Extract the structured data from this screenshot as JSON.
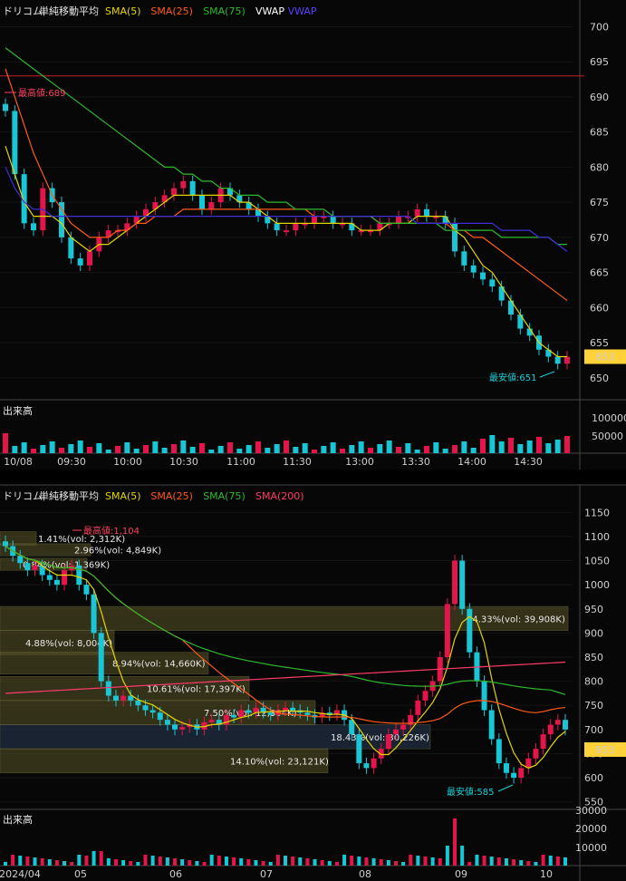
{
  "colors": {
    "bg": "#000000",
    "grid": "#1e1e1e",
    "up": "#e3154b",
    "down": "#19c6d6",
    "sma5": "#e5d400",
    "sma25": "#ff5a1a",
    "sma75": "#2db82d",
    "sma200": "#ff3b6b",
    "vwap": "#3d2fd8",
    "price_box": "#ffd23a",
    "volume_band": "#5a5428",
    "volume_band_highlight": "#2a3a55"
  },
  "intraday": {
    "legend": {
      "name": "ドリコム",
      "indicator": "単純移動平均",
      "items": [
        {
          "text": "SMA(5)",
          "color": "#e5d400"
        },
        {
          "text": "SMA(25)",
          "color": "#ff5a1a"
        },
        {
          "text": "SMA(75)",
          "color": "#2db82d"
        },
        {
          "text": "VWAP",
          "color": "#ffffff"
        },
        {
          "text": "VWAP",
          "color": "#5a3fff"
        }
      ]
    },
    "y_ticks": [
      "700",
      "695",
      "690",
      "685",
      "680",
      "675",
      "670",
      "665",
      "660",
      "655",
      "650"
    ],
    "current_price": "653",
    "high_label": "最高値:689",
    "low_label": "最安値:651",
    "volume_title": "出来高",
    "volume_ticks": [
      "100000",
      "50000"
    ],
    "x_labels": [
      "10/08",
      "09:30",
      "10:00",
      "10:30",
      "11:00",
      "11:30",
      "13:00",
      "13:30",
      "14:00",
      "14:30"
    ]
  },
  "daily": {
    "legend": {
      "name": "ドリコム",
      "indicator": "単純移動平均",
      "items": [
        {
          "text": "SMA(5)",
          "color": "#e5d400"
        },
        {
          "text": "SMA(25)",
          "color": "#ff5a1a"
        },
        {
          "text": "SMA(75)",
          "color": "#2db82d"
        },
        {
          "text": "SMA(200)",
          "color": "#ff3b6b"
        }
      ]
    },
    "y_ticks": [
      "1150",
      "1100",
      "1050",
      "1000",
      "950",
      "900",
      "850",
      "800",
      "750",
      "700",
      "650",
      "600",
      "550"
    ],
    "current_price": "653",
    "high_label": "最高値:1,104",
    "low_label": "最安値:585",
    "volume_title": "出来高",
    "volume_ticks": [
      "30000",
      "20000",
      "10000"
    ],
    "x_labels": [
      "2024/04",
      "05",
      "06",
      "07",
      "08",
      "09",
      "10"
    ],
    "volume_profile": [
      "1.41%(vol: 2,312K)",
      "2.96%(vol: 4,849K)",
      "0.84%(vol: 1,369K)",
      "24.33%(vol: 39,908K)",
      "4.88%(vol: 8,004K)",
      "8.94%(vol: 14,660K)",
      "10.61%(vol: 17,397K)",
      "7.50%(vol: 12,304K)",
      "18.43%(vol: 30,226K)",
      "14.10%(vol: 23,121K)"
    ]
  },
  "chart_data": [
    {
      "type": "candlestick",
      "title": "ドリコム 単純移動平均 (intraday 10/08)",
      "y_range": [
        647,
        702
      ],
      "x_labels": [
        "09:30",
        "10:00",
        "10:30",
        "11:00",
        "11:30",
        "13:00",
        "13:30",
        "14:00",
        "14:30"
      ],
      "close": [
        688,
        679,
        672,
        671,
        677,
        675,
        670,
        667,
        666,
        668,
        670,
        671,
        671,
        672,
        673,
        674,
        675,
        676,
        677,
        678,
        676,
        674,
        675,
        677,
        676,
        675,
        674,
        673,
        672,
        671,
        671,
        672,
        672,
        673,
        673,
        672,
        672,
        671,
        671,
        671,
        672,
        672,
        673,
        673,
        674,
        673,
        673,
        672,
        668,
        666,
        665,
        664,
        663,
        661,
        659,
        657,
        656,
        654,
        653,
        652,
        653
      ],
      "series": [
        {
          "name": "SMA(5)",
          "values": [
            683,
            679,
            675,
            673,
            673,
            673,
            672,
            670,
            669,
            668,
            669,
            669,
            670,
            671,
            672,
            673,
            674,
            675,
            676,
            676,
            676,
            676,
            676,
            676,
            676,
            675,
            675,
            674,
            673,
            672,
            672,
            672,
            672,
            672,
            672,
            672,
            672,
            672,
            671,
            671,
            671,
            672,
            672,
            672,
            673,
            673,
            673,
            673,
            671,
            670,
            668,
            666,
            665,
            663,
            661,
            659,
            657,
            655,
            654,
            653,
            653
          ]
        },
        {
          "name": "SMA(25)",
          "values": [
            694,
            690,
            686,
            682,
            679,
            676,
            674,
            672,
            671,
            670,
            670,
            670,
            671,
            671,
            672,
            672,
            673,
            673,
            673,
            674,
            674,
            674,
            674,
            674,
            674,
            674,
            674,
            674,
            674,
            674,
            674,
            674,
            674,
            673,
            673,
            673,
            673,
            673,
            673,
            673,
            672,
            672,
            672,
            672,
            672,
            672,
            672,
            672,
            671,
            671,
            670,
            670,
            669,
            668,
            667,
            666,
            665,
            664,
            663,
            662,
            661
          ]
        },
        {
          "name": "SMA(75)",
          "values": [
            697,
            696,
            695,
            694,
            693,
            692,
            691,
            690,
            689,
            688,
            687,
            686,
            685,
            684,
            683,
            682,
            681,
            680,
            680,
            679,
            679,
            678,
            678,
            677,
            677,
            676,
            676,
            676,
            675,
            675,
            675,
            674,
            674,
            674,
            674,
            673,
            673,
            673,
            673,
            673,
            672,
            672,
            672,
            672,
            672,
            672,
            672,
            671,
            671,
            671,
            671,
            671,
            671,
            670,
            670,
            670,
            670,
            670,
            670,
            669,
            669
          ]
        },
        {
          "name": "VWAP",
          "values": [
            680,
            677,
            675,
            674,
            674,
            673,
            673,
            673,
            673,
            673,
            673,
            673,
            673,
            673,
            673,
            673,
            673,
            673,
            673,
            673,
            673,
            673,
            673,
            673,
            673,
            673,
            673,
            673,
            673,
            673,
            673,
            673,
            673,
            673,
            673,
            673,
            673,
            673,
            673,
            673,
            673,
            673,
            673,
            673,
            672,
            672,
            672,
            672,
            672,
            672,
            672,
            672,
            672,
            671,
            671,
            671,
            671,
            670,
            670,
            669,
            668
          ]
        }
      ],
      "horizontal_line": 693,
      "high": 689,
      "low": 651,
      "last": 653
    },
    {
      "type": "candlestick",
      "title": "ドリコム 単純移動平均 (daily)",
      "y_range": [
        540,
        1160
      ],
      "x_labels": [
        "2024/04",
        "05",
        "06",
        "07",
        "08",
        "09",
        "10"
      ],
      "close": [
        1080,
        1060,
        1045,
        1030,
        1040,
        1020,
        1010,
        1000,
        1030,
        1040,
        1000,
        980,
        900,
        800,
        770,
        760,
        770,
        760,
        750,
        740,
        735,
        720,
        710,
        700,
        705,
        710,
        700,
        715,
        720,
        710,
        730,
        725,
        740,
        735,
        745,
        735,
        730,
        740,
        745,
        740,
        735,
        730,
        725,
        735,
        730,
        740,
        720,
        690,
        630,
        620,
        640,
        660,
        690,
        700,
        710,
        730,
        760,
        780,
        800,
        850,
        960,
        1050,
        950,
        860,
        800,
        740,
        680,
        630,
        610,
        600,
        620,
        640,
        660,
        690,
        710,
        720,
        700
      ]
    }
  ]
}
